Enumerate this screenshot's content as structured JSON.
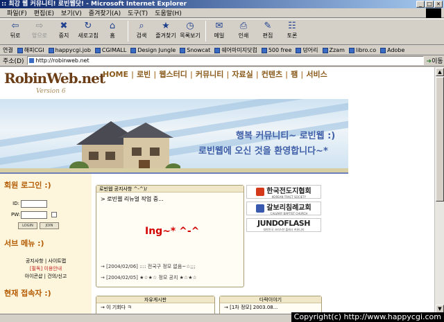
{
  "window": {
    "title": ":: 최강 웹 커뮤니티! 로빈웹닷! - Microsoft Internet Explorer"
  },
  "menu": [
    "파일(F)",
    "편집(E)",
    "보기(V)",
    "즐겨찾기(A)",
    "도구(T)",
    "도움말(H)"
  ],
  "toolbar": [
    {
      "label": "뒤로",
      "icon": "back-arrow-icon",
      "glyph": "⇦",
      "dim": false
    },
    {
      "label": "앞으로",
      "icon": "forward-arrow-icon",
      "glyph": "⇨",
      "dim": true
    },
    {
      "label": "중지",
      "icon": "stop-icon",
      "glyph": "✖",
      "dim": false
    },
    {
      "label": "새로고침",
      "icon": "refresh-icon",
      "glyph": "↻",
      "dim": false
    },
    {
      "label": "홈",
      "icon": "home-icon",
      "glyph": "⌂",
      "dim": false
    },
    {
      "label": "검색",
      "icon": "search-icon",
      "glyph": "⌕",
      "dim": false
    },
    {
      "label": "즐겨찾기",
      "icon": "favorites-icon",
      "glyph": "★",
      "dim": false
    },
    {
      "label": "목록보기",
      "icon": "history-icon",
      "glyph": "◷",
      "dim": false
    },
    {
      "label": "메일",
      "icon": "mail-icon",
      "glyph": "✉",
      "dim": false
    },
    {
      "label": "인쇄",
      "icon": "print-icon",
      "glyph": "⎙",
      "dim": false
    },
    {
      "label": "편집",
      "icon": "edit-icon",
      "glyph": "✎",
      "dim": false
    },
    {
      "label": "토론",
      "icon": "discuss-icon",
      "glyph": "☷",
      "dim": false
    }
  ],
  "links": {
    "label": "연결",
    "items": [
      "해피CGI",
      "happycgi.job",
      "CGIMALL",
      "Design Jungle",
      "Snowcat",
      "쉐어마미지닷컴",
      "500 free",
      "덩어리",
      "Zzam",
      "libro.co",
      "Adobe"
    ]
  },
  "address": {
    "label": "주소(D)",
    "value": "http://robinweb.net",
    "go": "이동"
  },
  "site": {
    "logo": "RobinWeb.net",
    "version": "Version 6",
    "nav": [
      "HOME",
      "로빈",
      "웹스터디",
      "커뮤니티",
      "자료실",
      "컨텐츠",
      "팸",
      "서비스"
    ],
    "banner_line1": "행복 커뮤니티~ 로빈웹 :)",
    "banner_line2": "로빈웹에 오신 것을 환영합니다~*",
    "login_title": "회원 로그인 :)",
    "login_id": "ID:",
    "login_pw": "PW:",
    "login_btn": "LOGIN",
    "join_btn": "JOIN",
    "service_title": "서브 메뉴 :)",
    "service_line1": "공지사항 | 사이트맵",
    "service_line2": "[필독] 이용안내",
    "service_line3": "아이콘샵 | 건의/신고",
    "visitors_title": "현재 접속자 :)",
    "notice_head": "로빈웹 공지사항 ^-^)/",
    "notice_line": "> 로빈웹 리뉴얼 작업 중...",
    "notice_big": "Ing~* ^-^",
    "notice_item1": "→ [2004/02/06] :::: 전국구 정모 없음~☆;;;",
    "notice_item2": "→ [2004/02/05] ★☆★☆ 정모 공지 ★☆★☆",
    "orgs": [
      {
        "name": "한국전도지협회",
        "sub": "KOREAN TRACT SOCIETY",
        "color": "#d43a1a"
      },
      {
        "name": "갈보리침례교회",
        "sub": "CALVARY BAPTIST CHURCH",
        "color": "#3a5ab0"
      },
      {
        "name": "JUNDOFLASH",
        "sub": "대한민국 크리스찬 플래시 커뮤니티",
        "color": ""
      }
    ],
    "board1_head": "자유게시판",
    "board1_item": "→ 이 기회다 ㅋ",
    "board2_head": "다락이야기",
    "board2_item": "→ [1차 정모] 2003.08..."
  },
  "copyright": "Copyright(c) http://www.happycgi.com"
}
